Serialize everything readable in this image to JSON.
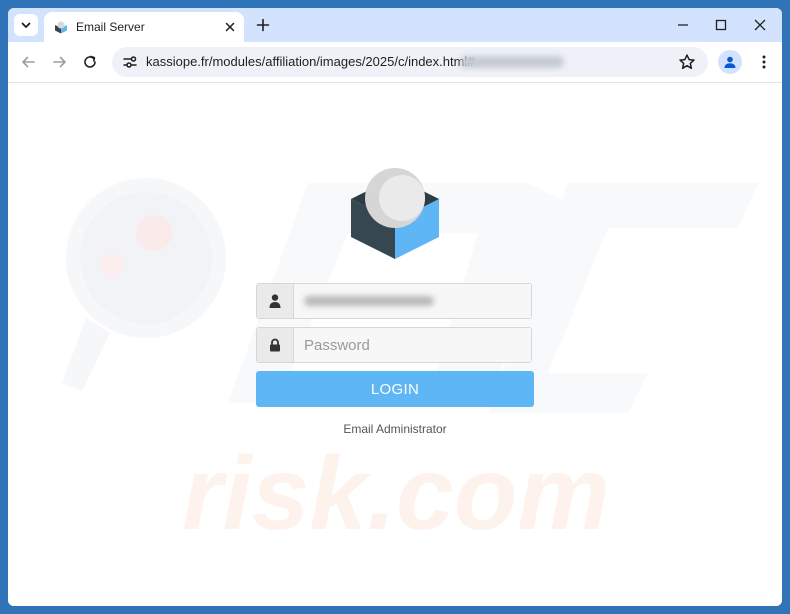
{
  "browser": {
    "tab": {
      "title": "Email Server"
    },
    "address_bar": {
      "url": "kassiope.fr/modules/affiliation/images/2025/c/index.html#"
    }
  },
  "login": {
    "password_placeholder": "Password",
    "login_label": "LOGIN",
    "footer_text": "Email Administrator"
  },
  "watermark": {
    "text": "risk.com"
  },
  "colors": {
    "tabbar_bg": "#d3e3fd",
    "button_bg": "#5eb6f5",
    "logo_blue": "#5eb6f5",
    "logo_dark": "#37474f"
  }
}
